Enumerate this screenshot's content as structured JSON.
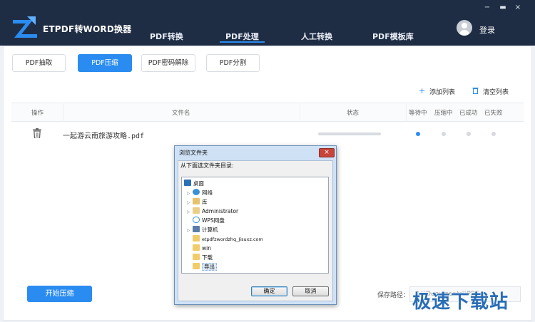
{
  "app": {
    "title": "ETPDF转WORD换器",
    "login": "登录",
    "window_controls": [
      "−",
      "▬",
      "×"
    ]
  },
  "nav": {
    "tabs": [
      {
        "label": "PDF转换",
        "active": false
      },
      {
        "label": "PDF处理",
        "active": true
      },
      {
        "label": "人工转换",
        "active": false
      },
      {
        "label": "PDF模板库",
        "active": false
      }
    ]
  },
  "subtabs": [
    {
      "label": "PDF抽取",
      "active": false
    },
    {
      "label": "PDF压缩",
      "active": true
    },
    {
      "label": "PDF密码解除",
      "active": false
    },
    {
      "label": "PDF分割",
      "active": false
    }
  ],
  "toolbar": {
    "add_list": "添加列表",
    "clear_list": "清空列表"
  },
  "table": {
    "headers": [
      "操作",
      "文件名",
      "状态",
      "等待中",
      "压缩中",
      "已成功",
      "已失败"
    ],
    "rows": [
      {
        "filename": "一起游云南旅游攻略.pdf",
        "stage": "等待中"
      }
    ]
  },
  "footer": {
    "start_button": "开始压缩",
    "save_path_label": "保存路径：",
    "save_path_value": "D:\\\\Documents\\\\PDF"
  },
  "watermark": "极速下载站",
  "dialog": {
    "title": "浏览文件夹",
    "close": "×",
    "prompt": "从下面选文件夹目录:",
    "tree": [
      {
        "label": "桌面",
        "icon": "desktop-icon",
        "level": 0,
        "arrow": ""
      },
      {
        "label": "网络",
        "icon": "network-icon",
        "level": 1,
        "arrow": "▷"
      },
      {
        "label": "库",
        "icon": "library-icon",
        "level": 1,
        "arrow": "▷"
      },
      {
        "label": "Administrator",
        "icon": "user-folder-icon",
        "level": 1,
        "arrow": "▷"
      },
      {
        "label": "WPS网盘",
        "icon": "cloud-icon",
        "level": 1,
        "arrow": ""
      },
      {
        "label": "计算机",
        "icon": "computer-icon",
        "level": 1,
        "arrow": "▷"
      },
      {
        "label": "etpdfzwordzhq_Jisuxz.com",
        "icon": "folder-icon",
        "level": 1,
        "arrow": ""
      },
      {
        "label": "win",
        "icon": "folder-icon",
        "level": 1,
        "arrow": ""
      },
      {
        "label": "下载",
        "icon": "folder-icon",
        "level": 1,
        "arrow": ""
      },
      {
        "label": "导出",
        "icon": "folder-icon",
        "level": 1,
        "arrow": "",
        "selected": true
      }
    ],
    "ok": "确定",
    "cancel": "取消"
  },
  "colors": {
    "header_bg": "#1f2d44",
    "accent": "#2a8cf0",
    "dialog_frame": "#cfe1f5"
  }
}
